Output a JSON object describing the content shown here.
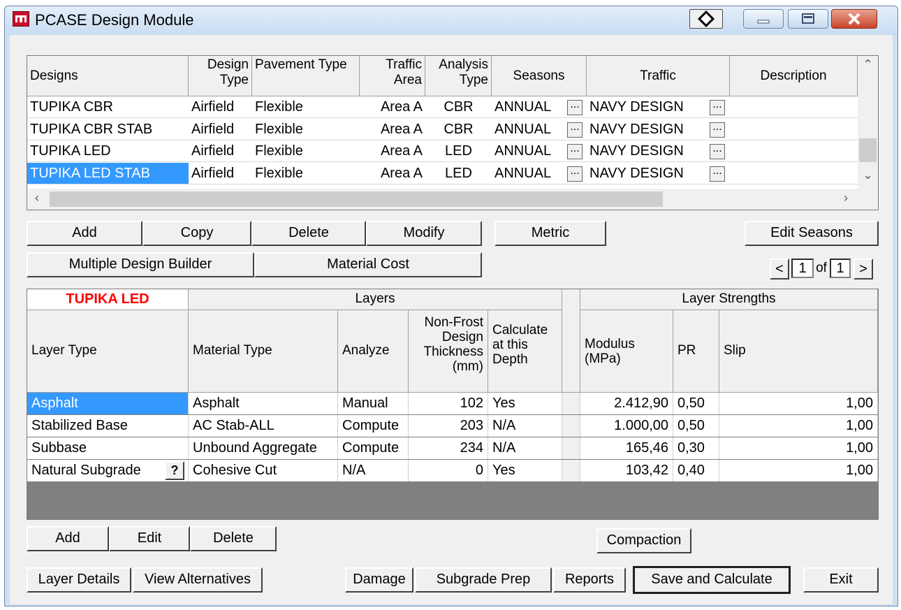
{
  "window": {
    "title": "PCASE Design Module"
  },
  "designs": {
    "headers": {
      "designs": "Designs",
      "design_type": "Design Type",
      "pavement_type": "Pavement Type",
      "traffic_area": "Traffic Area",
      "analysis_type": "Analysis Type",
      "seasons": "Seasons",
      "traffic": "Traffic",
      "description": "Description"
    },
    "rows": [
      {
        "name": "TUPIKA CBR",
        "design_type": "Airfield",
        "pavement_type": "Flexible",
        "traffic_area": "Area A",
        "analysis_type": "CBR",
        "seasons": "ANNUAL",
        "traffic": "NAVY DESIGN",
        "description": ""
      },
      {
        "name": "TUPIKA CBR STAB",
        "design_type": "Airfield",
        "pavement_type": "Flexible",
        "traffic_area": "Area A",
        "analysis_type": "CBR",
        "seasons": "ANNUAL",
        "traffic": "NAVY DESIGN",
        "description": ""
      },
      {
        "name": "TUPIKA LED",
        "design_type": "Airfield",
        "pavement_type": "Flexible",
        "traffic_area": "Area A",
        "analysis_type": "LED",
        "seasons": "ANNUAL",
        "traffic": "NAVY DESIGN",
        "description": ""
      },
      {
        "name": "TUPIKA LED STAB",
        "design_type": "Airfield",
        "pavement_type": "Flexible",
        "traffic_area": "Area A",
        "analysis_type": "LED",
        "seasons": "ANNUAL",
        "traffic": "NAVY DESIGN",
        "description": ""
      }
    ],
    "selected_row": "TUPIKA LED STAB",
    "ellipsis": "..."
  },
  "design_buttons": {
    "add": "Add",
    "copy": "Copy",
    "delete": "Delete",
    "modify": "Modify",
    "metric": "Metric",
    "edit_seasons": "Edit Seasons",
    "multiple_design_builder": "Multiple Design Builder",
    "material_cost": "Material Cost"
  },
  "pager": {
    "prev": "<",
    "current": "1",
    "of": "of",
    "total": "1",
    "next": ">"
  },
  "layers": {
    "design_name": "TUPIKA LED",
    "group_layers": "Layers",
    "group_strengths": "Layer Strengths",
    "headers": {
      "layer_type": "Layer Type",
      "material_type": "Material Type",
      "analyze": "Analyze",
      "thickness_l1": "Non-Frost",
      "thickness_l2": "Design",
      "thickness_l3": "Thickness",
      "thickness_l4": "(mm)",
      "calc_l1": "Calculate",
      "calc_l2": "at this",
      "calc_l3": "Depth",
      "modulus_l1": "Modulus",
      "modulus_l2": "(MPa)",
      "pr": "PR",
      "slip": "Slip"
    },
    "rows": [
      {
        "layer_type": "Asphalt",
        "material_type": "Asphalt",
        "analyze": "Manual",
        "thickness": "102",
        "calc": "Yes",
        "modulus": "2.412,90",
        "pr": "0,50",
        "slip": "1,00"
      },
      {
        "layer_type": "Stabilized Base",
        "material_type": "AC Stab-ALL",
        "analyze": "Compute",
        "thickness": "203",
        "calc": "N/A",
        "modulus": "1.000,00",
        "pr": "0,50",
        "slip": "1,00"
      },
      {
        "layer_type": "Subbase",
        "material_type": "Unbound Aggregate",
        "analyze": "Compute",
        "thickness": "234",
        "calc": "N/A",
        "modulus": "165,46",
        "pr": "0,30",
        "slip": "1,00"
      },
      {
        "layer_type": "Natural Subgrade",
        "material_type": "Cohesive Cut",
        "analyze": "N/A",
        "thickness": "0",
        "calc": "Yes",
        "modulus": "103,42",
        "pr": "0,40",
        "slip": "1,00"
      }
    ],
    "help_glyph": "?"
  },
  "layer_buttons": {
    "add": "Add",
    "edit": "Edit",
    "delete": "Delete",
    "compaction": "Compaction"
  },
  "bottom_buttons": {
    "layer_details": "Layer Details",
    "view_alternatives": "View Alternatives",
    "damage": "Damage",
    "subgrade_prep": "Subgrade Prep",
    "reports": "Reports",
    "save_and_calculate": "Save and Calculate",
    "exit": "Exit"
  },
  "colors": {
    "selection": "#3399ff",
    "design_name": "#ff0000",
    "client_bg": "#f0f0f0"
  }
}
